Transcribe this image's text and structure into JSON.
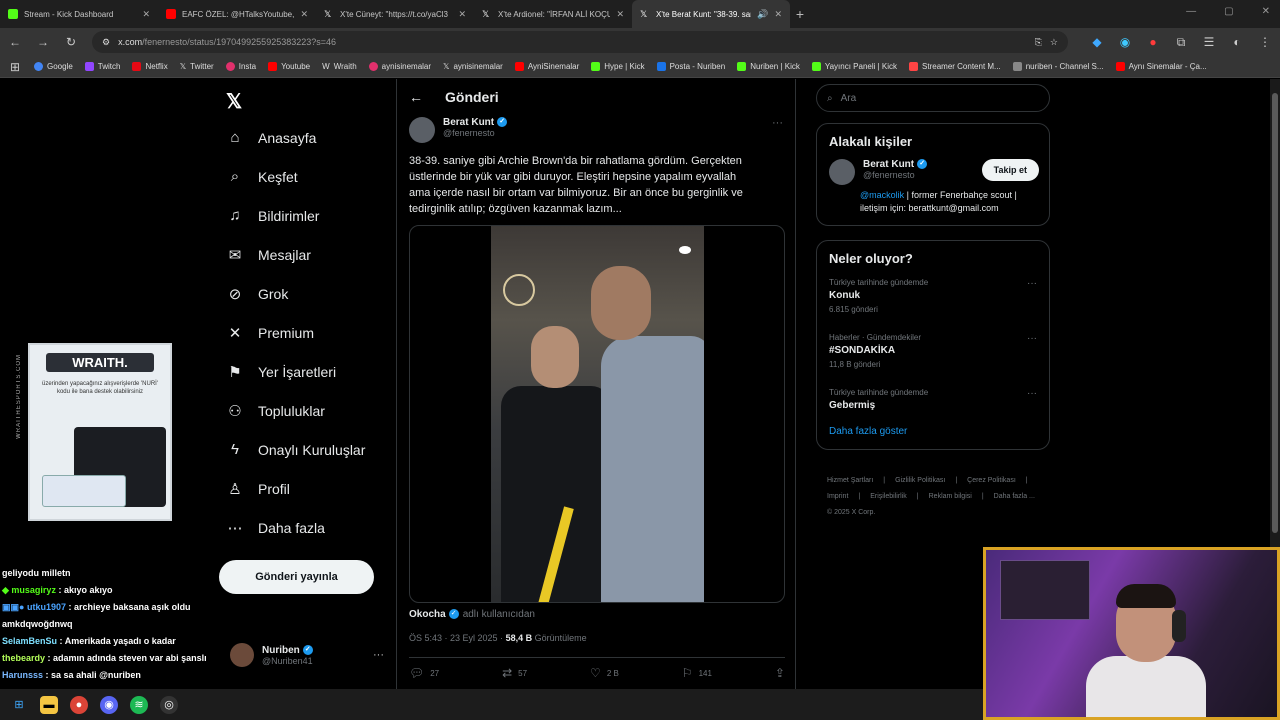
{
  "tabs": [
    {
      "title": "Stream - Kick Dashboard",
      "color": "#53fc18"
    },
    {
      "title": "EAFC ÖZEL: @HTalksYoutube, @",
      "color": "#ff0000"
    },
    {
      "title": "X'te Cüneyt: \"https://t.co/yaCl3",
      "color": "#ffffff"
    },
    {
      "title": "X'te Ardionel: \"İRFAN ALİ KOÇU",
      "color": "#ffffff"
    },
    {
      "title": "X'te Berat Kunt: \"38-39. san",
      "color": "#ffffff",
      "active": true
    }
  ],
  "address": {
    "host": "x.com",
    "path": "/fenernesto/status/1970499255925383223?s=46"
  },
  "bookmarks": [
    {
      "label": "Google",
      "color": "#4285f4"
    },
    {
      "label": "Twitch",
      "color": "#9146ff"
    },
    {
      "label": "Netflix",
      "color": "#e50914"
    },
    {
      "label": "Twitter",
      "color": "#ffffff"
    },
    {
      "label": "Insta",
      "color": "#e1306c"
    },
    {
      "label": "Youtube",
      "color": "#ff0000"
    },
    {
      "label": "Wraith",
      "color": "#ffffff"
    },
    {
      "label": "aynisinemalar",
      "color": "#e1306c"
    },
    {
      "label": "aynisinemalar",
      "color": "#ffffff"
    },
    {
      "label": "AyniSinemalar",
      "color": "#ff0000"
    },
    {
      "label": "Hype | Kick",
      "color": "#53fc18"
    },
    {
      "label": "Posta - Nuriben",
      "color": "#1a73e8"
    },
    {
      "label": "Nuriben | Kick",
      "color": "#53fc18"
    },
    {
      "label": "Yayıncı Paneli | Kick",
      "color": "#53fc18"
    },
    {
      "label": "Streamer Content M...",
      "color": "#ff4444"
    },
    {
      "label": "nuriben - Channel S...",
      "color": "#888888"
    },
    {
      "label": "Aynı Sinemalar - Ça...",
      "color": "#ff0000"
    }
  ],
  "nav": [
    {
      "label": "Anasayfa",
      "icon": "⌂"
    },
    {
      "label": "Keşfet",
      "icon": "⌕"
    },
    {
      "label": "Bildirimler",
      "icon": "🔔"
    },
    {
      "label": "Mesajlar",
      "icon": "✉"
    },
    {
      "label": "Grok",
      "icon": "⊘"
    },
    {
      "label": "Premium",
      "icon": "✕"
    },
    {
      "label": "Yer İşaretleri",
      "icon": "⚑"
    },
    {
      "label": "Topluluklar",
      "icon": "⚇"
    },
    {
      "label": "Onaylı Kuruluşlar",
      "icon": "ϟ"
    },
    {
      "label": "Profil",
      "icon": "♙"
    },
    {
      "label": "Daha fazla",
      "icon": "⋯"
    }
  ],
  "post_button": "Gönderi yayınla",
  "account": {
    "name": "Nuriben",
    "handle": "@Nuriben41"
  },
  "ad": {
    "brand": "WRAITH.",
    "text": "üzerinden yapacağınız alışverişlerde 'NURİ' kodu ile bana destek olabilirsiniz",
    "side": "WRAITHESPORTS.COM"
  },
  "chat": [
    {
      "user": "",
      "msg": "geliyodu milletn",
      "color": "#ffffff"
    },
    {
      "user": "musagiryz",
      "msg": ": akıyo akıyo",
      "color": "#53fc18"
    },
    {
      "user": "utku1907",
      "msg": ": archieye baksana aşık oldu",
      "color": "#4aa3ff"
    },
    {
      "user": "",
      "msg": "amkdqwoğdnwq",
      "color": "#ffffff"
    },
    {
      "user": "SelamBenSu",
      "msg": ": Amerikada yaşadı o kadar",
      "color": "#7ee0ff"
    },
    {
      "user": "thebeardy",
      "msg": ": adamın adında steven var abi şanslı",
      "color": "#b4ff5a"
    },
    {
      "user": "Harunsss",
      "msg": ": sa sa ahali @nuriben",
      "color": "#7ab8ff"
    }
  ],
  "header": {
    "title": "Gönderi"
  },
  "post": {
    "name": "Berat Kunt",
    "handle": "@fenernesto",
    "text": "38-39. saniye gibi Archie Brown'da bir rahatlama gördüm. Gerçekten üstlerinde bir yük var gibi duruyor. Eleştiri hepsine yapalım eyvallah ama içerde nasıl bir ortam var bilmiyoruz. Bir an önce bu gerginlik ve tedirginlik atılıp; özgüven kazanmak lazım...",
    "source_name": "Okocha",
    "source_suffix": "adlı kullanıcıdan",
    "time": "ÖS 5:43 · 23 Eyl 2025 ·",
    "views": "58,4 B",
    "views_label": "Görüntüleme",
    "replies": "27",
    "reposts": "57",
    "likes": "2 B",
    "bookmarks": "141"
  },
  "search": {
    "placeholder": "Ara"
  },
  "related": {
    "title": "Alakalı kişiler",
    "name": "Berat Kunt",
    "handle": "@fenernesto",
    "follow": "Takip et",
    "bio_mention": "@mackolik",
    "bio_rest": " | former Fenerbahçe scout | iletişim için: berattkunt@gmail.com"
  },
  "trends": {
    "title": "Neler oluyor?",
    "items": [
      {
        "context": "Türkiye tarihinde gündemde",
        "name": "Konuk",
        "count": "6.815 gönderi"
      },
      {
        "context": "Haberler · Gündemdekiler",
        "name": "#SONDAKİKA",
        "count": "11,8 B gönderi"
      },
      {
        "context": "Türkiye tarihinde gündemde",
        "name": "Gebermiş",
        "count": ""
      }
    ],
    "show_more": "Daha fazla göster"
  },
  "footer": [
    "Hizmet Şartları",
    "|",
    "Gizlilik Politikası",
    "|",
    "Çerez Politikası",
    "|",
    "Imprint",
    "|",
    "Erişilebilirlik",
    "|",
    "Reklam bilgisi",
    "|",
    "Daha fazla ...",
    "© 2025 X Corp."
  ]
}
